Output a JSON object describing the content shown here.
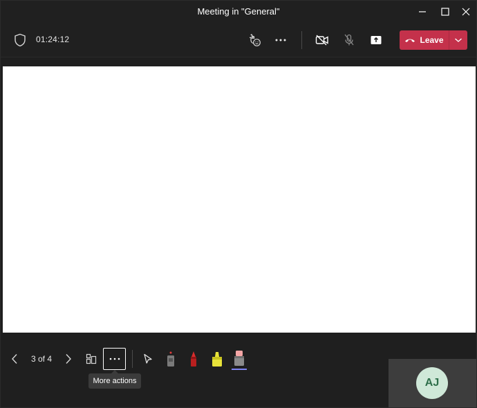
{
  "window": {
    "title": "Meeting in \"General\""
  },
  "meeting_bar": {
    "timer": "01:24:12",
    "leave_label": "Leave"
  },
  "presentation": {
    "pager": "3 of 4",
    "tooltip": "More actions"
  },
  "participant": {
    "initials": "AJ"
  },
  "colors": {
    "leave": "#c4314b",
    "background": "#1f1f1f",
    "stage": "#ffffff",
    "avatar_bg": "#cfe8d8",
    "avatar_text": "#2e6e4a"
  }
}
